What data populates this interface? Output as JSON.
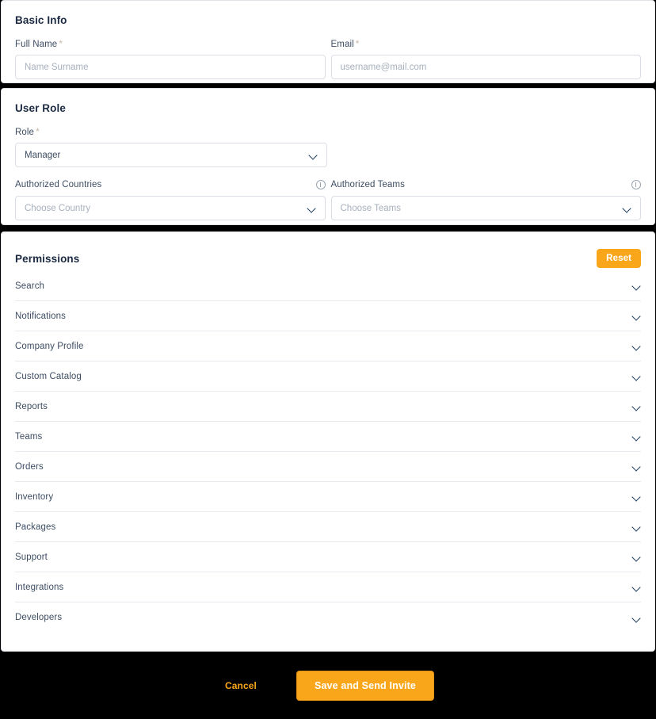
{
  "basic_info": {
    "title": "Basic Info",
    "fields": [
      {
        "label": "Full Name",
        "required": "*",
        "placeholder": "Name Surname",
        "value": ""
      },
      {
        "label": "Email",
        "required": "*",
        "placeholder": "username@mail.com",
        "value": ""
      }
    ]
  },
  "user_role": {
    "title": "User Role",
    "role": {
      "label": "Role",
      "required": "*",
      "value": "Manager",
      "icon": "chevron-down-icon"
    },
    "authorized_countries": {
      "label": "Authorized Countries",
      "info_icon": "info-icon",
      "placeholder": "Choose Country",
      "icon": "chevron-down-icon"
    },
    "authorized_teams": {
      "label": "Authorized Teams",
      "info_icon": "info-icon",
      "placeholder": "Choose Teams",
      "icon": "chevron-down-icon"
    }
  },
  "permissions": {
    "title": "Permissions",
    "reset_label": "Reset",
    "row_icon": "chevron-down-icon",
    "items": [
      {
        "label": "Search"
      },
      {
        "label": "Notifications"
      },
      {
        "label": "Company Profile"
      },
      {
        "label": "Custom Catalog"
      },
      {
        "label": "Reports"
      },
      {
        "label": "Teams"
      },
      {
        "label": "Orders"
      },
      {
        "label": "Inventory"
      },
      {
        "label": "Packages"
      },
      {
        "label": "Support"
      },
      {
        "label": "Integrations"
      },
      {
        "label": "Developers"
      }
    ]
  },
  "footer": {
    "cancel_label": "Cancel",
    "save_label": "Save and Send Invite"
  },
  "colors": {
    "accent": "#faa61a",
    "text": "#3d4d63",
    "heading": "#1b2a41",
    "placeholder": "#a7b0bd",
    "border": "#d9dee5",
    "page_background": "#000000",
    "card_background": "#ffffff"
  }
}
